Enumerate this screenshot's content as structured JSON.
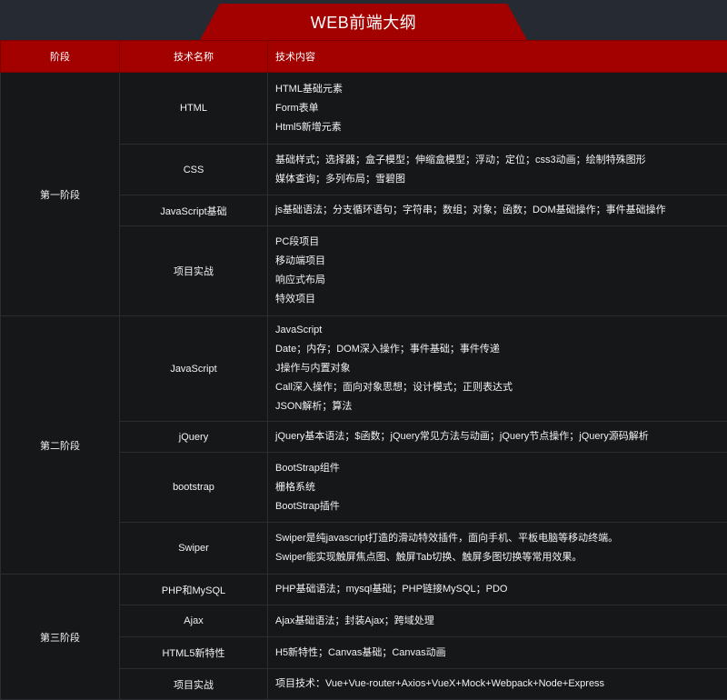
{
  "title": "WEB前端大纲",
  "headers": {
    "stage": "阶段",
    "tech": "技术名称",
    "content": "技术内容"
  },
  "stages": [
    {
      "name": "第一阶段",
      "rows": [
        {
          "tech": "HTML",
          "lines": [
            "HTML基础元素",
            "Form表单",
            "Html5新增元素"
          ]
        },
        {
          "tech": "CSS",
          "lines": [
            "基础样式；选择器；盒子模型；伸缩盒模型；浮动；定位；css3动画；绘制特殊图形",
            "媒体查询；多列布局；雪碧图"
          ]
        },
        {
          "tech": "JavaScript基础",
          "lines": [
            "js基础语法；分支循环语句；字符串；数组；对象；函数；DOM基础操作；事件基础操作"
          ]
        },
        {
          "tech": "项目实战",
          "lines": [
            "PC段项目",
            "移动端项目",
            "响应式布局",
            "特效项目"
          ]
        }
      ]
    },
    {
      "name": "第二阶段",
      "rows": [
        {
          "tech": "JavaScript",
          "lines": [
            "JavaScript",
            "Date；内存；DOM深入操作；事件基础；事件传递",
            "J操作与内置对象",
            "Call深入操作；面向对象思想；设计模式；正则表达式",
            "JSON解析；算法"
          ]
        },
        {
          "tech": "jQuery",
          "lines": [
            "jQuery基本语法；$函数；jQuery常见方法与动画；jQuery节点操作；jQuery源码解析"
          ]
        },
        {
          "tech": "bootstrap",
          "lines": [
            "BootStrap组件",
            "栅格系统",
            "BootStrap插件"
          ]
        },
        {
          "tech": "Swiper",
          "lines": [
            "Swiper是纯javascript打造的滑动特效插件，面向手机、平板电脑等移动终端。",
            "Swiper能实现触屏焦点图、触屏Tab切换、触屏多图切换等常用效果。"
          ]
        }
      ]
    },
    {
      "name": "第三阶段",
      "rows": [
        {
          "tech": "PHP和MySQL",
          "lines": [
            "PHP基础语法；mysql基础；PHP链接MySQL；PDO"
          ]
        },
        {
          "tech": "Ajax",
          "lines": [
            "Ajax基础语法；封装Ajax；跨域处理"
          ]
        },
        {
          "tech": "HTML5新特性",
          "lines": [
            "H5新特性；Canvas基础；Canvas动画"
          ]
        },
        {
          "tech": "项目实战",
          "lines": [
            "项目技术：Vue+Vue-router+Axios+VueX+Mock+Webpack+Node+Express"
          ]
        }
      ]
    }
  ]
}
